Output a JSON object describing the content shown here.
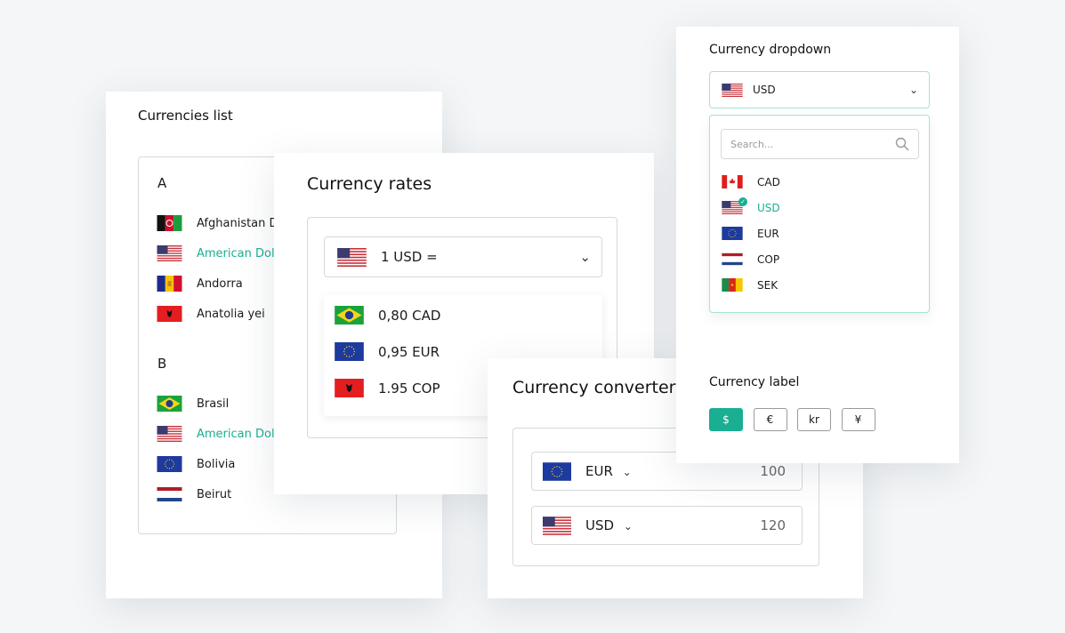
{
  "colors": {
    "accent": "#1aae93",
    "border": "#d6d8da"
  },
  "currencies_list": {
    "title": "Currencies list",
    "groups": [
      {
        "letter": "A",
        "items": [
          {
            "label": "Afghanistan D",
            "flag": "af",
            "selected": false
          },
          {
            "label": "American Dol",
            "flag": "us",
            "selected": true
          },
          {
            "label": "Andorra",
            "flag": "ad",
            "selected": false
          },
          {
            "label": "Anatolia yei",
            "flag": "al",
            "selected": false
          }
        ]
      },
      {
        "letter": "B",
        "items": [
          {
            "label": "Brasil",
            "flag": "br",
            "selected": false
          },
          {
            "label": "American Dol",
            "flag": "us",
            "selected": true
          },
          {
            "label": "Bolivia",
            "flag": "eu",
            "selected": false
          },
          {
            "label": "Beirut",
            "flag": "nl",
            "selected": false
          }
        ]
      }
    ]
  },
  "currency_rates": {
    "title": "Currency rates",
    "base": {
      "label": "1 USD =",
      "flag": "us"
    },
    "rates": [
      {
        "label": "0,80 CAD",
        "flag": "br"
      },
      {
        "label": "0,95 EUR",
        "flag": "eu"
      },
      {
        "label": "1.95 COP",
        "flag": "al"
      }
    ]
  },
  "currency_converter": {
    "title": "Currency converter",
    "rows": [
      {
        "currency": "EUR",
        "flag": "eu",
        "amount": "100"
      },
      {
        "currency": "USD",
        "flag": "us",
        "amount": "120"
      }
    ]
  },
  "currency_dropdown": {
    "title": "Currency dropdown",
    "selected": {
      "label": "USD",
      "flag": "us"
    },
    "search_placeholder": "Search...",
    "options": [
      {
        "label": "CAD",
        "flag": "ca",
        "selected": false
      },
      {
        "label": "USD",
        "flag": "us",
        "selected": true
      },
      {
        "label": "EUR",
        "flag": "eu",
        "selected": false
      },
      {
        "label": "COP",
        "flag": "nl",
        "selected": false
      },
      {
        "label": "SEK",
        "flag": "cm",
        "selected": false
      }
    ]
  },
  "currency_label": {
    "title": "Currency label",
    "symbols": [
      {
        "label": "$",
        "active": true
      },
      {
        "label": "€",
        "active": false
      },
      {
        "label": "kr",
        "active": false
      },
      {
        "label": "¥",
        "active": false
      }
    ]
  }
}
